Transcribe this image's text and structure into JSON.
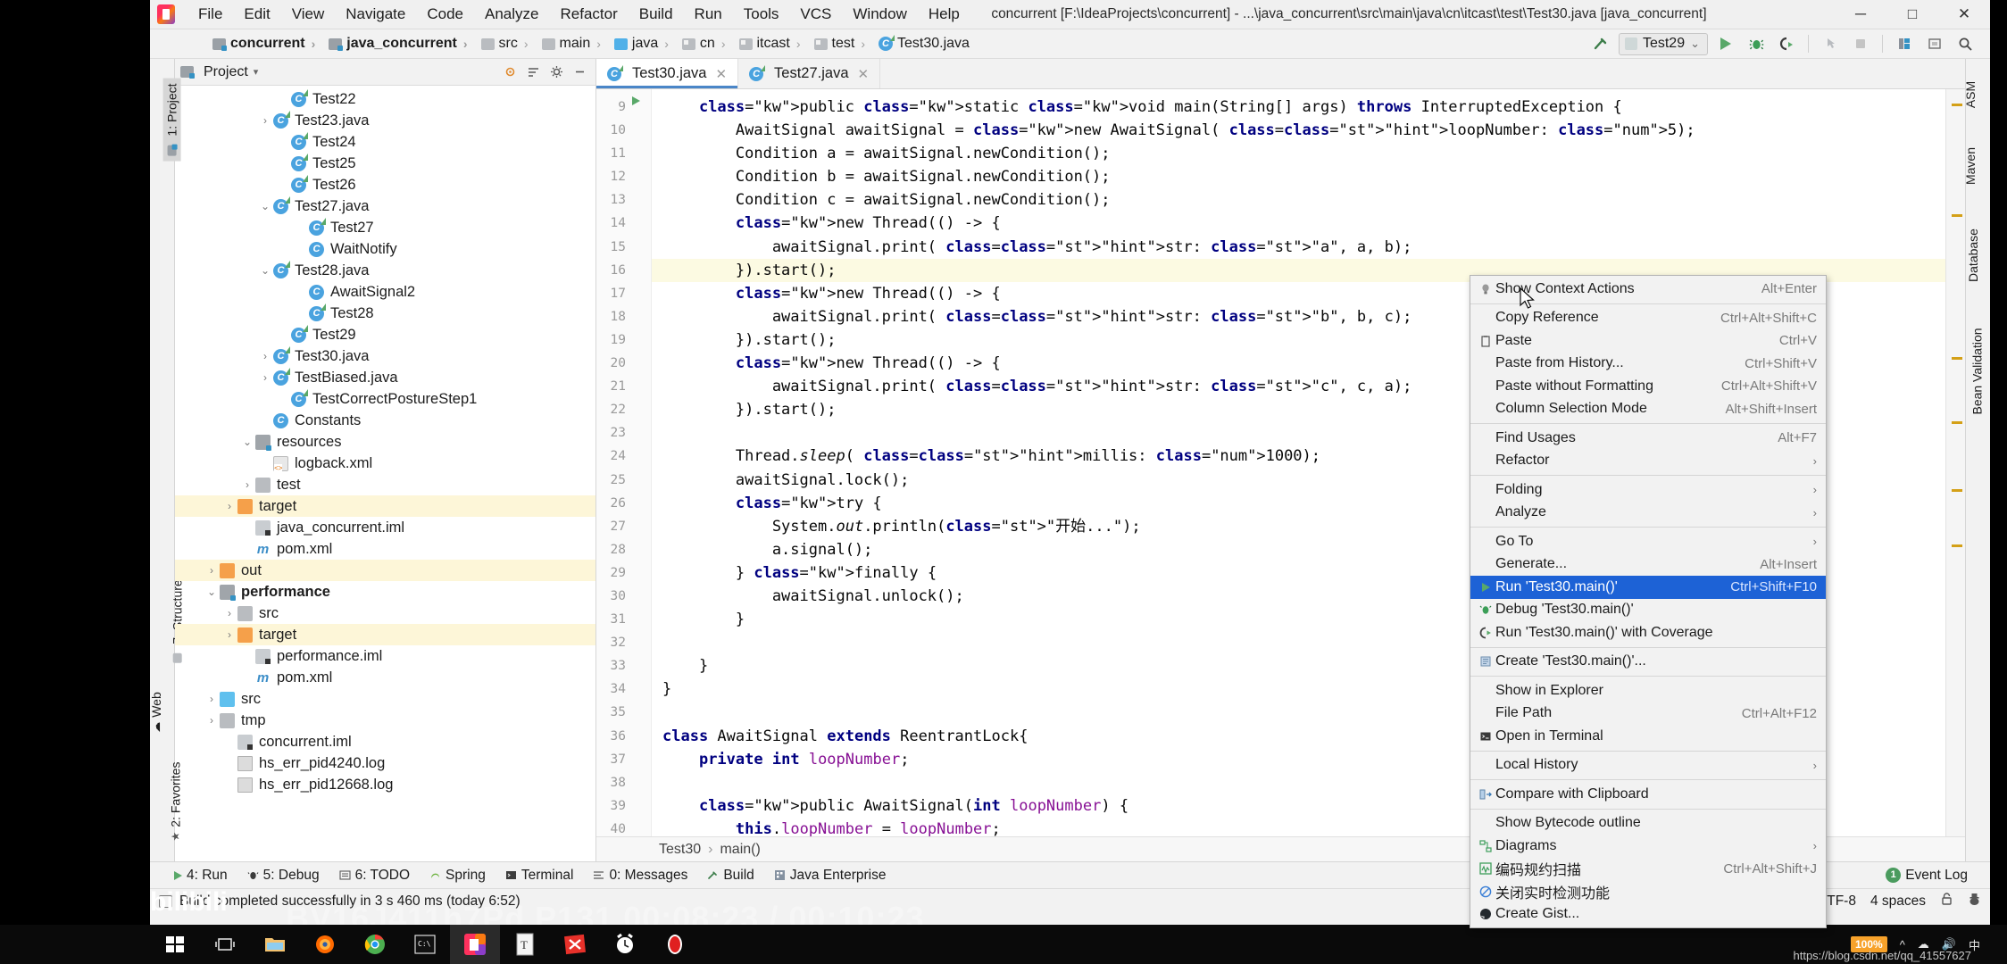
{
  "titlebar": {
    "menus": [
      "File",
      "Edit",
      "View",
      "Navigate",
      "Code",
      "Analyze",
      "Refactor",
      "Build",
      "Run",
      "Tools",
      "VCS",
      "Window",
      "Help"
    ],
    "window_title": "concurrent [F:\\IdeaProjects\\concurrent] - ...\\java_concurrent\\src\\main\\java\\cn\\itcast\\test\\Test30.java [java_concurrent]",
    "minimize": "─",
    "maximize": "□",
    "close": "✕"
  },
  "navbar": {
    "crumbs": [
      {
        "label": "concurrent",
        "icon": "module-icon",
        "bold": true
      },
      {
        "label": "java_concurrent",
        "icon": "module-icon",
        "bold": true
      },
      {
        "label": "src",
        "icon": "folder-icon",
        "bold": false
      },
      {
        "label": "main",
        "icon": "folder-icon",
        "bold": false
      },
      {
        "label": "java",
        "icon": "source-folder-icon",
        "bold": false
      },
      {
        "label": "cn",
        "icon": "package-icon",
        "bold": false
      },
      {
        "label": "itcast",
        "icon": "package-icon",
        "bold": false
      },
      {
        "label": "test",
        "icon": "package-icon",
        "bold": false
      },
      {
        "label": "Test30.java",
        "icon": "java-class-icon",
        "bold": false
      }
    ],
    "run_config": "Test29",
    "run_config_caret": "⌄"
  },
  "project_panel": {
    "title": "Project",
    "caret": "▾",
    "tree": [
      {
        "label": "Test22",
        "depth": 5,
        "arrow": "",
        "icon": "java-class-run-icon"
      },
      {
        "label": "Test23.java",
        "depth": 4,
        "arrow": "›",
        "icon": "java-class-run-icon"
      },
      {
        "label": "Test24",
        "depth": 5,
        "arrow": "",
        "icon": "java-class-run-icon"
      },
      {
        "label": "Test25",
        "depth": 5,
        "arrow": "",
        "icon": "java-class-run-icon"
      },
      {
        "label": "Test26",
        "depth": 5,
        "arrow": "",
        "icon": "java-class-run-icon"
      },
      {
        "label": "Test27.java",
        "depth": 4,
        "arrow": "⌄",
        "icon": "java-class-run-icon"
      },
      {
        "label": "Test27",
        "depth": 6,
        "arrow": "",
        "icon": "java-class-run-icon"
      },
      {
        "label": "WaitNotify",
        "depth": 6,
        "arrow": "",
        "icon": "java-class-icon"
      },
      {
        "label": "Test28.java",
        "depth": 4,
        "arrow": "⌄",
        "icon": "java-class-run-icon"
      },
      {
        "label": "AwaitSignal2",
        "depth": 6,
        "arrow": "",
        "icon": "java-class-icon"
      },
      {
        "label": "Test28",
        "depth": 6,
        "arrow": "",
        "icon": "java-class-run-icon"
      },
      {
        "label": "Test29",
        "depth": 5,
        "arrow": "",
        "icon": "java-class-run-icon"
      },
      {
        "label": "Test30.java",
        "depth": 4,
        "arrow": "›",
        "icon": "java-class-run-icon"
      },
      {
        "label": "TestBiased.java",
        "depth": 4,
        "arrow": "›",
        "icon": "java-class-run-icon"
      },
      {
        "label": "TestCorrectPostureStep1",
        "depth": 5,
        "arrow": "",
        "icon": "java-class-run-icon"
      },
      {
        "label": "Constants",
        "depth": 4,
        "arrow": "",
        "icon": "java-class-icon"
      },
      {
        "label": "resources",
        "depth": 3,
        "arrow": "⌄",
        "icon": "resource-folder-icon"
      },
      {
        "label": "logback.xml",
        "depth": 4,
        "arrow": "",
        "icon": "xml-file-icon"
      },
      {
        "label": "test",
        "depth": 3,
        "arrow": "›",
        "icon": "folder-icon"
      },
      {
        "label": "target",
        "depth": 2,
        "arrow": "›",
        "icon": "folder-orange-icon",
        "highlight": true
      },
      {
        "label": "java_concurrent.iml",
        "depth": 3,
        "arrow": "",
        "icon": "iml-file-icon"
      },
      {
        "label": "pom.xml",
        "depth": 3,
        "arrow": "",
        "icon": "maven-icon"
      },
      {
        "label": "out",
        "depth": 1,
        "arrow": "›",
        "icon": "folder-orange-icon",
        "highlight": true
      },
      {
        "label": "performance",
        "depth": 1,
        "arrow": "⌄",
        "icon": "module-icon",
        "bold": true
      },
      {
        "label": "src",
        "depth": 2,
        "arrow": "›",
        "icon": "folder-icon"
      },
      {
        "label": "target",
        "depth": 2,
        "arrow": "›",
        "icon": "folder-orange-icon",
        "highlight": true
      },
      {
        "label": "performance.iml",
        "depth": 3,
        "arrow": "",
        "icon": "iml-file-icon"
      },
      {
        "label": "pom.xml",
        "depth": 3,
        "arrow": "",
        "icon": "maven-icon"
      },
      {
        "label": "src",
        "depth": 1,
        "arrow": "›",
        "icon": "folder-blue-icon"
      },
      {
        "label": "tmp",
        "depth": 1,
        "arrow": "›",
        "icon": "folder-icon"
      },
      {
        "label": "concurrent.iml",
        "depth": 2,
        "arrow": "",
        "icon": "iml-file-icon"
      },
      {
        "label": "hs_err_pid4240.log",
        "depth": 2,
        "arrow": "",
        "icon": "log-file-icon"
      },
      {
        "label": "hs_err_pid12668.log",
        "depth": 2,
        "arrow": "",
        "icon": "log-file-icon"
      }
    ]
  },
  "left_tabs": [
    {
      "label": "1: Project",
      "selected": true
    },
    {
      "label": "7: Structure",
      "selected": false
    },
    {
      "label": "Web",
      "selected": false
    },
    {
      "label": "2: Favorites",
      "selected": false
    }
  ],
  "right_tabs": [
    "ASM",
    "Maven",
    "Database",
    "Bean Validation"
  ],
  "editor": {
    "tabs": [
      {
        "label": "Test30.java",
        "active": true,
        "close": "✕"
      },
      {
        "label": "Test27.java",
        "active": false,
        "close": "✕"
      }
    ],
    "first_line": 9,
    "lines": [
      {
        "n": 9,
        "text": "    public static void main(String[] args) throws InterruptedException {"
      },
      {
        "n": 10,
        "text": "        AwaitSignal awaitSignal = new AwaitSignal( loopNumber: 5);"
      },
      {
        "n": 11,
        "text": "        Condition a = awaitSignal.newCondition();"
      },
      {
        "n": 12,
        "text": "        Condition b = awaitSignal.newCondition();"
      },
      {
        "n": 13,
        "text": "        Condition c = awaitSignal.newCondition();"
      },
      {
        "n": 14,
        "text": "        new Thread(() -> {"
      },
      {
        "n": 15,
        "text": "            awaitSignal.print( str: \"a\", a, b);"
      },
      {
        "n": 16,
        "text": "        }).start();",
        "highlight": true
      },
      {
        "n": 17,
        "text": "        new Thread(() -> {"
      },
      {
        "n": 18,
        "text": "            awaitSignal.print( str: \"b\", b, c);"
      },
      {
        "n": 19,
        "text": "        }).start();"
      },
      {
        "n": 20,
        "text": "        new Thread(() -> {"
      },
      {
        "n": 21,
        "text": "            awaitSignal.print( str: \"c\", c, a);"
      },
      {
        "n": 22,
        "text": "        }).start();"
      },
      {
        "n": 23,
        "text": ""
      },
      {
        "n": 24,
        "text": "        Thread.sleep( millis: 1000);"
      },
      {
        "n": 25,
        "text": "        awaitSignal.lock();"
      },
      {
        "n": 26,
        "text": "        try {"
      },
      {
        "n": 27,
        "text": "            System.out.println(\"开始...\");"
      },
      {
        "n": 28,
        "text": "            a.signal();"
      },
      {
        "n": 29,
        "text": "        } finally {"
      },
      {
        "n": 30,
        "text": "            awaitSignal.unlock();"
      },
      {
        "n": 31,
        "text": "        }"
      },
      {
        "n": 32,
        "text": ""
      },
      {
        "n": 33,
        "text": "    }"
      },
      {
        "n": 34,
        "text": "}"
      },
      {
        "n": 35,
        "text": ""
      },
      {
        "n": 36,
        "text": "class AwaitSignal extends ReentrantLock{"
      },
      {
        "n": 37,
        "text": "    private int loopNumber;"
      },
      {
        "n": 38,
        "text": ""
      },
      {
        "n": 39,
        "text": "    public AwaitSignal(int loopNumber) {"
      },
      {
        "n": 40,
        "text": "        this.loopNumber = loopNumber;"
      }
    ],
    "breadcrumb": [
      "Test30",
      "main()"
    ],
    "breadcrumb_sep": "›"
  },
  "context_menu": {
    "items": [
      {
        "label": "Show Context Actions",
        "shortcut": "Alt+Enter",
        "icon": "lightbulb-icon"
      },
      {
        "sep": true
      },
      {
        "label": "Copy Reference",
        "shortcut": "Ctrl+Alt+Shift+C",
        "icon": ""
      },
      {
        "label": "Paste",
        "shortcut": "Ctrl+V",
        "icon": "clipboard-icon"
      },
      {
        "label": "Paste from History...",
        "shortcut": "Ctrl+Shift+V",
        "icon": ""
      },
      {
        "label": "Paste without Formatting",
        "shortcut": "Ctrl+Alt+Shift+V",
        "icon": ""
      },
      {
        "label": "Column Selection Mode",
        "shortcut": "Alt+Shift+Insert",
        "icon": ""
      },
      {
        "sep": true
      },
      {
        "label": "Find Usages",
        "shortcut": "Alt+F7",
        "icon": ""
      },
      {
        "label": "Refactor",
        "shortcut": "",
        "icon": "",
        "submenu": true
      },
      {
        "sep": true
      },
      {
        "label": "Folding",
        "shortcut": "",
        "icon": "",
        "submenu": true
      },
      {
        "label": "Analyze",
        "shortcut": "",
        "icon": "",
        "submenu": true
      },
      {
        "sep": true
      },
      {
        "label": "Go To",
        "shortcut": "",
        "icon": "",
        "submenu": true
      },
      {
        "label": "Generate...",
        "shortcut": "Alt+Insert",
        "icon": ""
      },
      {
        "label": "Run 'Test30.main()'",
        "shortcut": "Ctrl+Shift+F10",
        "icon": "run-icon",
        "selected": true
      },
      {
        "label": "Debug 'Test30.main()'",
        "shortcut": "",
        "icon": "debug-icon"
      },
      {
        "label": "Run 'Test30.main()' with Coverage",
        "shortcut": "",
        "icon": "coverage-icon"
      },
      {
        "sep": true
      },
      {
        "label": "Create 'Test30.main()'...",
        "shortcut": "",
        "icon": "create-config-icon"
      },
      {
        "sep": true
      },
      {
        "label": "Show in Explorer",
        "shortcut": "",
        "icon": ""
      },
      {
        "label": "File Path",
        "shortcut": "Ctrl+Alt+F12",
        "icon": ""
      },
      {
        "label": "Open in Terminal",
        "shortcut": "",
        "icon": "terminal-icon"
      },
      {
        "sep": true
      },
      {
        "label": "Local History",
        "shortcut": "",
        "icon": "",
        "submenu": true
      },
      {
        "sep": true
      },
      {
        "label": "Compare with Clipboard",
        "shortcut": "",
        "icon": "compare-icon"
      },
      {
        "sep": true
      },
      {
        "label": "Show Bytecode outline",
        "shortcut": "",
        "icon": ""
      },
      {
        "label": "Diagrams",
        "shortcut": "",
        "icon": "diagram-icon",
        "submenu": true
      },
      {
        "label": "编码规约扫描",
        "shortcut": "Ctrl+Alt+Shift+J",
        "icon": "scan-icon"
      },
      {
        "label": "关闭实时检测功能",
        "shortcut": "",
        "icon": "disable-icon"
      },
      {
        "label": "Create Gist...",
        "shortcut": "",
        "icon": "github-icon"
      }
    ]
  },
  "bottom_tools": [
    {
      "label": "4: Run",
      "icon": "run-icon"
    },
    {
      "label": "5: Debug",
      "icon": "debug-icon"
    },
    {
      "label": "6: TODO",
      "icon": "todo-icon"
    },
    {
      "label": "Spring",
      "icon": "spring-icon"
    },
    {
      "label": "Terminal",
      "icon": "terminal-icon"
    },
    {
      "label": "0: Messages",
      "icon": "messages-icon"
    },
    {
      "label": "Build",
      "icon": "build-icon"
    },
    {
      "label": "Java Enterprise",
      "icon": "java-enterprise-icon"
    }
  ],
  "statusbar": {
    "message": "Build completed successfully in 3 s 460 ms (today 6:52)",
    "event_log": "Event Log",
    "event_count": "1",
    "encoding": "UTF-8",
    "indent": "4 spaces",
    "lock_icon": "lock-icon",
    "inspection_icon": "inspector-icon"
  },
  "taskbar": {
    "zoom_level": "100%",
    "apps": [
      "windows-start-icon",
      "task-view-icon",
      "file-explorer-icon",
      "firefox-icon",
      "chrome-icon",
      "cmd-icon",
      "intellij-icon",
      "typora-icon",
      "xmind-icon",
      "clock-icon",
      "record-icon"
    ],
    "tray_time": ""
  },
  "overlay": {
    "bili_logo": "bilibili",
    "video_id": "BV16J411h7Pd P131 00:08:23 / 00:10:23",
    "csdn": "https://blog.csdn.net/qq_41557627"
  }
}
